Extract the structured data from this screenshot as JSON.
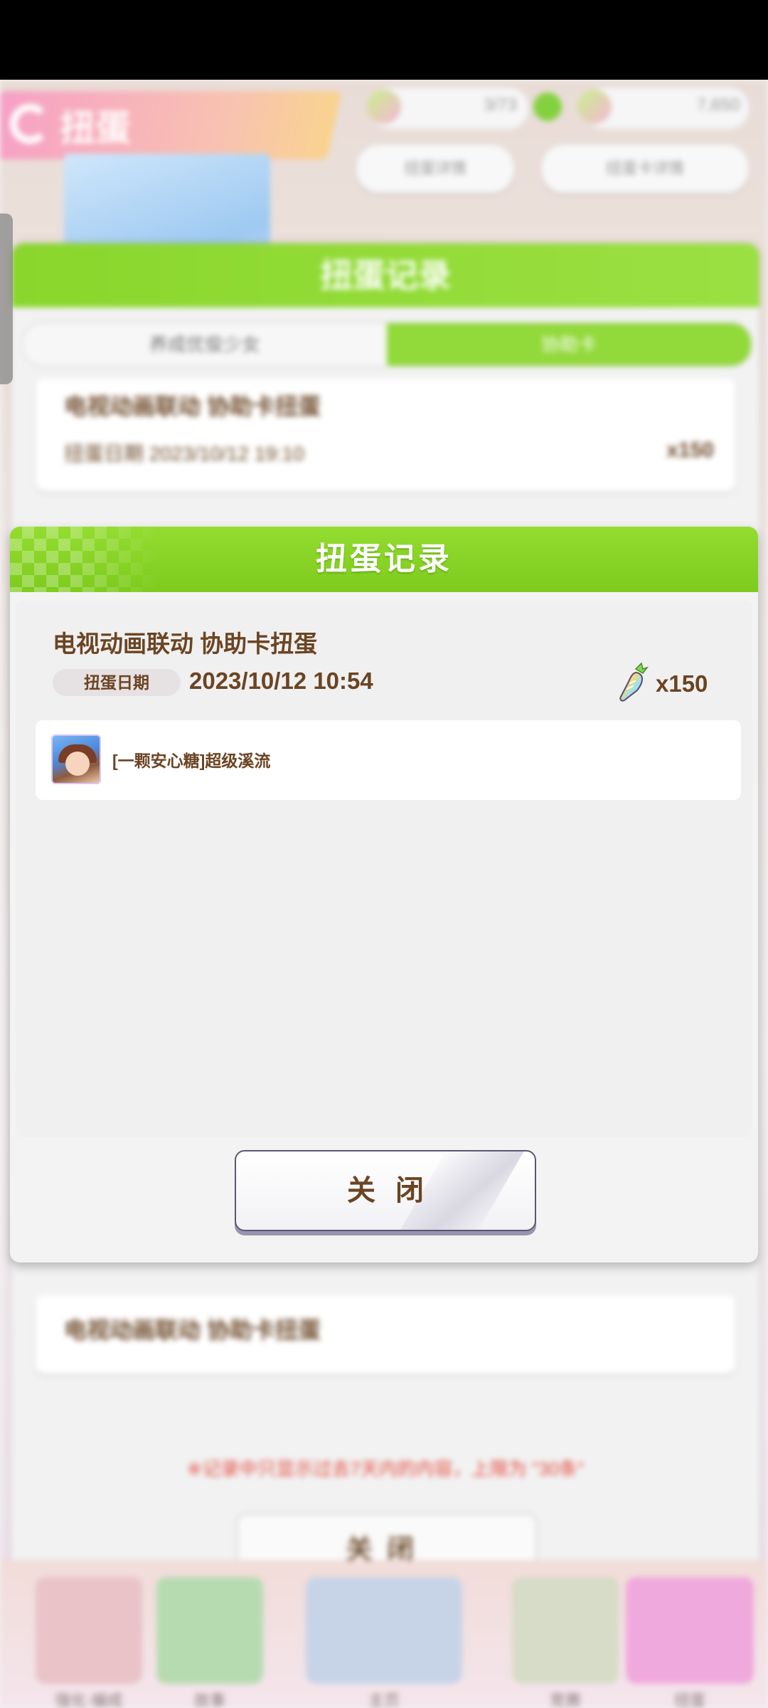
{
  "background": {
    "header_title": "扭蛋",
    "coins": [
      {
        "value": "3/73"
      },
      {
        "value": "7,650"
      }
    ],
    "pill_buttons": [
      "扭蛋详情",
      "扭蛋卡详情"
    ],
    "dialog_title": "扭蛋记录",
    "tabs": {
      "left": "养成优俊少女",
      "right": "协助卡"
    },
    "cards": [
      {
        "title": "电视动画联动  协助卡扭蛋",
        "meta": "扭蛋日期  2023/10/12  19:10",
        "qty": "x150"
      },
      {
        "title": "电视动画联动  协助卡扭蛋"
      }
    ],
    "notice": "※记录中只显示过去7天内的内容，上限为 \"30条\"",
    "close_label": "关闭",
    "nav": [
      "强化·编成",
      "故事",
      "主页",
      "竞赛",
      "扭蛋"
    ]
  },
  "modal": {
    "title": "扭蛋记录",
    "record": {
      "title": "电视动画联动  协助卡扭蛋",
      "date_label": "扭蛋日期",
      "date": "2023/10/12  10:54",
      "quantity": "x150",
      "currency_icon": "carrot-icon",
      "results": [
        {
          "name": "[一颗安心糖]超级溪流",
          "icon": "support-card-thumbnail"
        }
      ]
    },
    "close_label": "关闭"
  },
  "colors": {
    "header_green": "#7dcb1d",
    "text_brown": "#6b4423",
    "notice_red": "#e34a3d"
  }
}
